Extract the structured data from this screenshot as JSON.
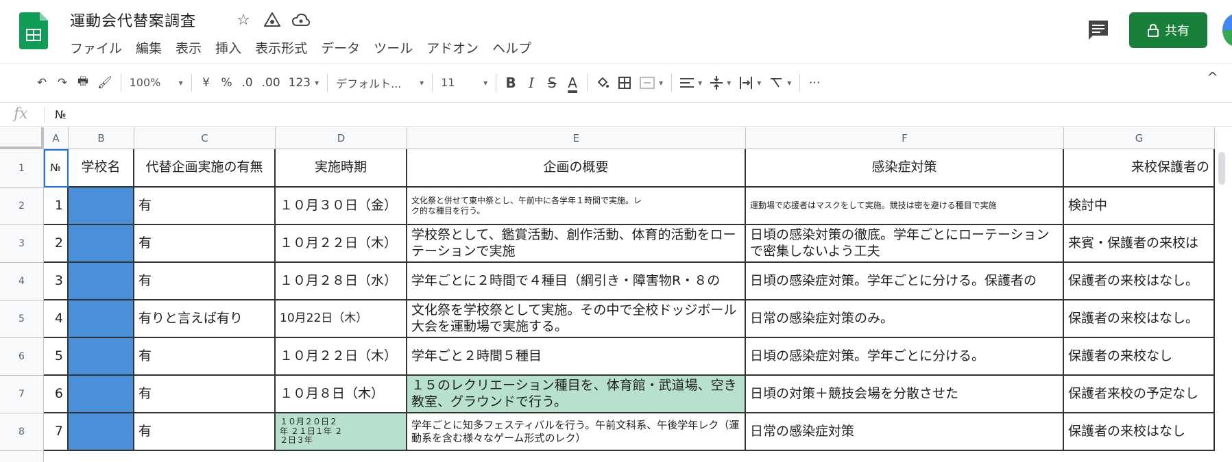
{
  "doc": {
    "title": "運動会代替案調査",
    "menu": [
      "ファイル",
      "編集",
      "表示",
      "挿入",
      "表示形式",
      "データ",
      "ツール",
      "アドオン",
      "ヘルプ"
    ],
    "share_label": "共有"
  },
  "toolbar": {
    "undo": "↶",
    "redo": "↷",
    "print": "🖶",
    "paint": "🖌",
    "zoom": "100%",
    "currency": "¥",
    "percent": "%",
    "dec_less": ".0",
    "dec_more": ".00",
    "num_fmt": "123",
    "font": "デフォルト...",
    "size": "11",
    "bold": "B",
    "italic": "I",
    "strike": "S",
    "text_color": "A",
    "more": "⋯",
    "collapse": "^"
  },
  "formula": {
    "fx": "fx",
    "value": "№"
  },
  "columns": [
    "A",
    "B",
    "C",
    "D",
    "E",
    "F",
    "G"
  ],
  "rows": [
    {
      "num": "1",
      "a": "№",
      "b": "学校名",
      "c": "代替企画実施の有無",
      "d": "実施時期",
      "e": "企画の概要",
      "f": "感染症対策",
      "g": "来校保護者の"
    },
    {
      "num": "2",
      "a": "1",
      "b": "",
      "c": "有",
      "d": "１０月３０日（金）",
      "e": "文化祭と併せて東中祭とし、午前中に各学年１時間で実施。レク的な種目を行う。",
      "f": "運動場で応援者はマスクをして実施。競技は密を避ける種目で実施",
      "g": "検討中"
    },
    {
      "num": "3",
      "a": "2",
      "b": "",
      "c": "有",
      "d": "１０月２２日（木）",
      "e": "学校祭として、鑑賞活動、創作活動、体育的活動をローテーションで実施",
      "f": "日頃の感染対策の徹底。学年ごとにローテーションで密集しないよう工夫",
      "g": "来賓・保護者の来校は"
    },
    {
      "num": "4",
      "a": "3",
      "b": "",
      "c": "有",
      "d": "１０月２８日（水）",
      "e": "学年ごとに２時間で４種目（綱引き・障害物R・８の",
      "f": "日頃の感染症対策。学年ごとに分ける。保護者の",
      "g": "保護者の来校はなし。"
    },
    {
      "num": "5",
      "a": "4",
      "b": "",
      "c": "有りと言えば有り",
      "d": "10月22日（木）",
      "e": "文化祭を学校祭として実施。その中で全校ドッジボール大会を運動場で実施する。",
      "f": "日常の感染症対策のみ。",
      "g": "保護者の来校はなし。"
    },
    {
      "num": "6",
      "a": "5",
      "b": "",
      "c": "有",
      "d": "１０月２２日（木）",
      "e": "学年ごと２時間５種目",
      "f": "日頃の感染症対策。学年ごとに分ける。",
      "g": "保護者の来校なし"
    },
    {
      "num": "7",
      "a": "6",
      "b": "",
      "c": "有",
      "d": "１０月８日（木）",
      "e": "１５のレクリエーション種目を、体育館・武道場、空き教室、グラウンドで行う。",
      "f": "日頃の対策＋競技会場を分散させた",
      "g": "保護者来校の予定なし"
    },
    {
      "num": "8",
      "a": "7",
      "b": "",
      "c": "有",
      "d": "１０月２０日２年 ２１日１年 ２２日３年",
      "e": "学年ごとに知多フェスティバルを行う。午前文科系、午後学年レク（運動系を含む様々なゲーム形式のレク）",
      "f": "日常の感染症対策",
      "g": "保護者の来校はなし"
    }
  ],
  "colors": {
    "share": "#188038",
    "school_fill": "#4a90d9",
    "highlight": "#b7e1cd",
    "selection": "#1a73e8"
  }
}
